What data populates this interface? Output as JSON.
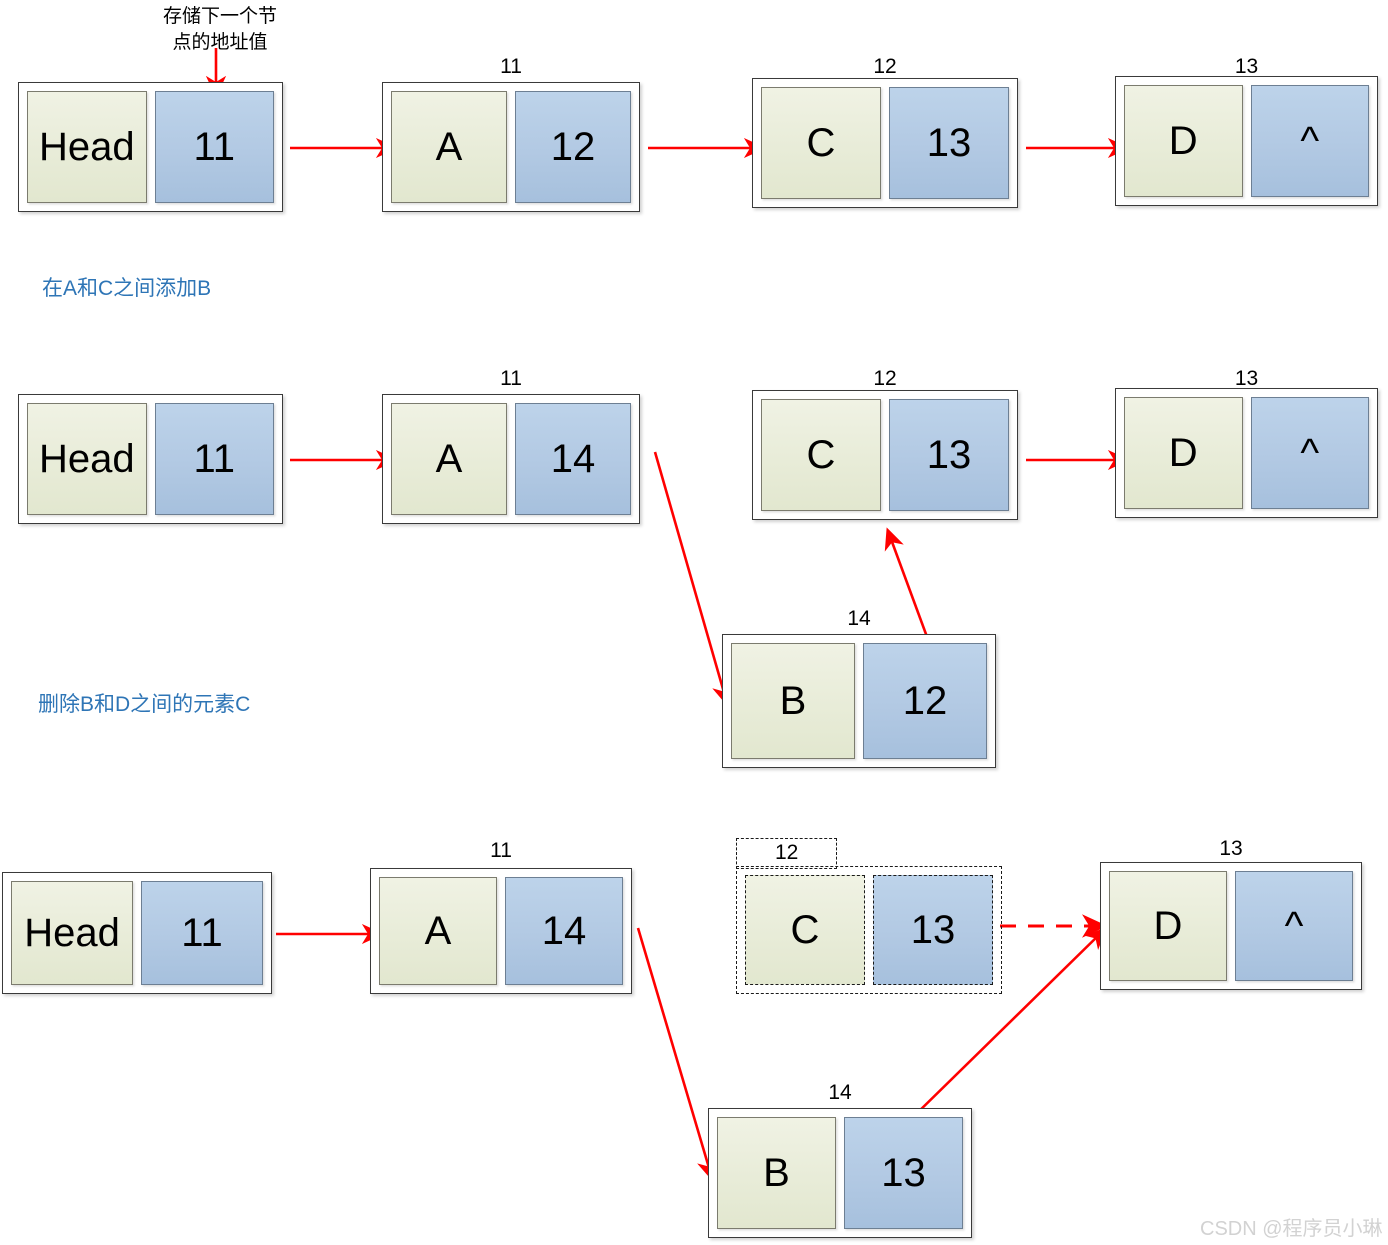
{
  "meta": {
    "title": "Linked list insertion and deletion diagram",
    "accent_red": "#ff0000",
    "caption_blue": "#2e75b6",
    "data_cell_color": "#e8ecd8",
    "pointer_cell_color": "#b2c9e3",
    "watermark_color": "#d2d2d2"
  },
  "annotation": {
    "pointer_note": "存储下一个节\n点的地址值"
  },
  "captions": {
    "insert": "在A和C之间添加B",
    "delete": "删除B和D之间的元素C"
  },
  "watermark": {
    "text": "CSDN @程序员小琳"
  },
  "rows": [
    {
      "id": "row-original",
      "nodes": [
        {
          "name": "head",
          "addr": "",
          "data": "Head",
          "ptr": "11",
          "dashed": false
        },
        {
          "name": "a",
          "addr": "11",
          "data": "A",
          "ptr": "12",
          "dashed": false
        },
        {
          "name": "c",
          "addr": "12",
          "data": "C",
          "ptr": "13",
          "dashed": false
        },
        {
          "name": "d",
          "addr": "13",
          "data": "D",
          "ptr": "^",
          "dashed": false
        }
      ]
    },
    {
      "id": "row-insert",
      "nodes": [
        {
          "name": "head",
          "addr": "",
          "data": "Head",
          "ptr": "11",
          "dashed": false
        },
        {
          "name": "a",
          "addr": "11",
          "data": "A",
          "ptr": "14",
          "dashed": false
        },
        {
          "name": "c",
          "addr": "12",
          "data": "C",
          "ptr": "13",
          "dashed": false
        },
        {
          "name": "d",
          "addr": "13",
          "data": "D",
          "ptr": "^",
          "dashed": false
        },
        {
          "name": "b",
          "addr": "14",
          "data": "B",
          "ptr": "12",
          "dashed": false
        }
      ]
    },
    {
      "id": "row-delete",
      "nodes": [
        {
          "name": "head",
          "addr": "",
          "data": "Head",
          "ptr": "11",
          "dashed": false
        },
        {
          "name": "a",
          "addr": "11",
          "data": "A",
          "ptr": "14",
          "dashed": false
        },
        {
          "name": "c",
          "addr": "12",
          "data": "C",
          "ptr": "13",
          "dashed": true
        },
        {
          "name": "d",
          "addr": "13",
          "data": "D",
          "ptr": "^",
          "dashed": false
        },
        {
          "name": "b",
          "addr": "14",
          "data": "B",
          "ptr": "13",
          "dashed": false
        }
      ]
    }
  ],
  "chart_data": {
    "type": "diagram",
    "title": "Singly linked list: insert B between A and C, then delete C",
    "sequences": [
      {
        "name": "original",
        "order": [
          "Head/11",
          "A@11/12",
          "C@12/13",
          "D@13/^"
        ]
      },
      {
        "name": "after_insert",
        "order": [
          "Head/11",
          "A@11/14",
          "B@14/12",
          "C@12/13",
          "D@13/^"
        ]
      },
      {
        "name": "after_delete",
        "order": [
          "Head/11",
          "A@11/14",
          "B@14/13",
          "D@13/^"
        ],
        "removed": [
          "C@12/13"
        ]
      }
    ]
  }
}
